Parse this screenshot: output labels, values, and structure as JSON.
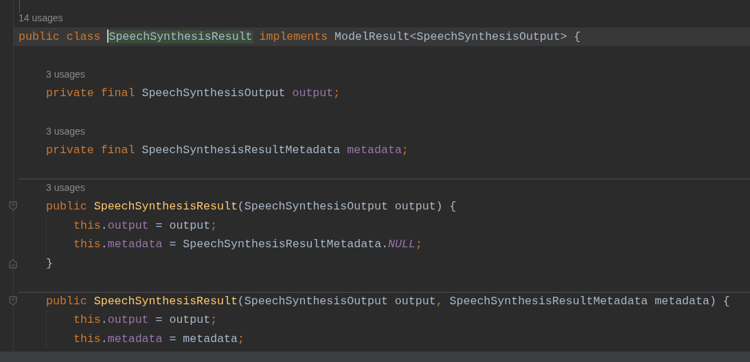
{
  "editor": {
    "lines": [
      {
        "kind": "usages",
        "text": "14 usages"
      },
      {
        "kind": "code",
        "current": true,
        "tokens": [
          {
            "kind": "keyword",
            "text": "public class "
          },
          {
            "kind": "plain",
            "text": "SpeechSynthesisResult",
            "highlighted": true,
            "caret": true
          },
          {
            "kind": "keyword",
            "text": " implements "
          },
          {
            "kind": "plain",
            "text": "ModelResult<SpeechSynthesisOutput> {"
          }
        ],
        "children": [
          {
            "kind": "blank"
          },
          {
            "kind": "usages",
            "text": "3 usages"
          },
          {
            "kind": "code",
            "tokens": [
              {
                "kind": "keyword",
                "text": "private final "
              },
              {
                "kind": "plain",
                "text": "SpeechSynthesisOutput "
              },
              {
                "kind": "field",
                "text": "output"
              },
              {
                "kind": "keyword",
                "text": ";"
              }
            ]
          },
          {
            "kind": "blank"
          },
          {
            "kind": "usages",
            "text": "3 usages"
          },
          {
            "kind": "code",
            "tokens": [
              {
                "kind": "keyword",
                "text": "private final "
              },
              {
                "kind": "plain",
                "text": "SpeechSynthesisResultMetadata "
              },
              {
                "kind": "field",
                "text": "metadata"
              },
              {
                "kind": "keyword",
                "text": ";"
              }
            ]
          },
          {
            "kind": "blank"
          },
          {
            "kind": "usages",
            "text": "3 usages",
            "method_separator": true
          },
          {
            "kind": "code",
            "fold_start": true,
            "tokens": [
              {
                "kind": "keyword",
                "text": "public "
              },
              {
                "kind": "declaration",
                "text": "SpeechSynthesisResult"
              },
              {
                "kind": "plain",
                "text": "(SpeechSynthesisOutput output) {"
              }
            ],
            "children": [
              {
                "kind": "code",
                "tokens": [
                  {
                    "kind": "keyword",
                    "text": "this"
                  },
                  {
                    "kind": "plain",
                    "text": "."
                  },
                  {
                    "kind": "field",
                    "text": "output"
                  },
                  {
                    "kind": "plain",
                    "text": " = output"
                  },
                  {
                    "kind": "keyword",
                    "text": ";"
                  }
                ]
              },
              {
                "kind": "code",
                "tokens": [
                  {
                    "kind": "keyword",
                    "text": "this"
                  },
                  {
                    "kind": "plain",
                    "text": "."
                  },
                  {
                    "kind": "field",
                    "text": "metadata"
                  },
                  {
                    "kind": "plain",
                    "text": " = SpeechSynthesisResultMetadata."
                  },
                  {
                    "kind": "static",
                    "text": "NULL"
                  },
                  {
                    "kind": "keyword",
                    "text": ";"
                  }
                ]
              }
            ]
          },
          {
            "kind": "code",
            "fold_end": true,
            "tokens": [
              {
                "kind": "plain",
                "text": "}"
              }
            ]
          },
          {
            "kind": "blank"
          },
          {
            "kind": "code",
            "fold_start": true,
            "method_separator": true,
            "tokens": [
              {
                "kind": "keyword",
                "text": "public "
              },
              {
                "kind": "declaration",
                "text": "SpeechSynthesisResult"
              },
              {
                "kind": "plain",
                "text": "(SpeechSynthesisOutput output"
              },
              {
                "kind": "keyword",
                "text": ", "
              },
              {
                "kind": "plain",
                "text": "SpeechSynthesisResultMetadata metadata) {"
              }
            ],
            "children": [
              {
                "kind": "code",
                "tokens": [
                  {
                    "kind": "keyword",
                    "text": "this"
                  },
                  {
                    "kind": "plain",
                    "text": "."
                  },
                  {
                    "kind": "field",
                    "text": "output"
                  },
                  {
                    "kind": "plain",
                    "text": " = output"
                  },
                  {
                    "kind": "keyword",
                    "text": ";"
                  }
                ]
              },
              {
                "kind": "code",
                "tokens": [
                  {
                    "kind": "keyword",
                    "text": "this"
                  },
                  {
                    "kind": "plain",
                    "text": "."
                  },
                  {
                    "kind": "field",
                    "text": "metadata"
                  },
                  {
                    "kind": "plain",
                    "text": " = metadata"
                  },
                  {
                    "kind": "keyword",
                    "text": ";"
                  }
                ]
              }
            ]
          }
        ]
      }
    ]
  }
}
